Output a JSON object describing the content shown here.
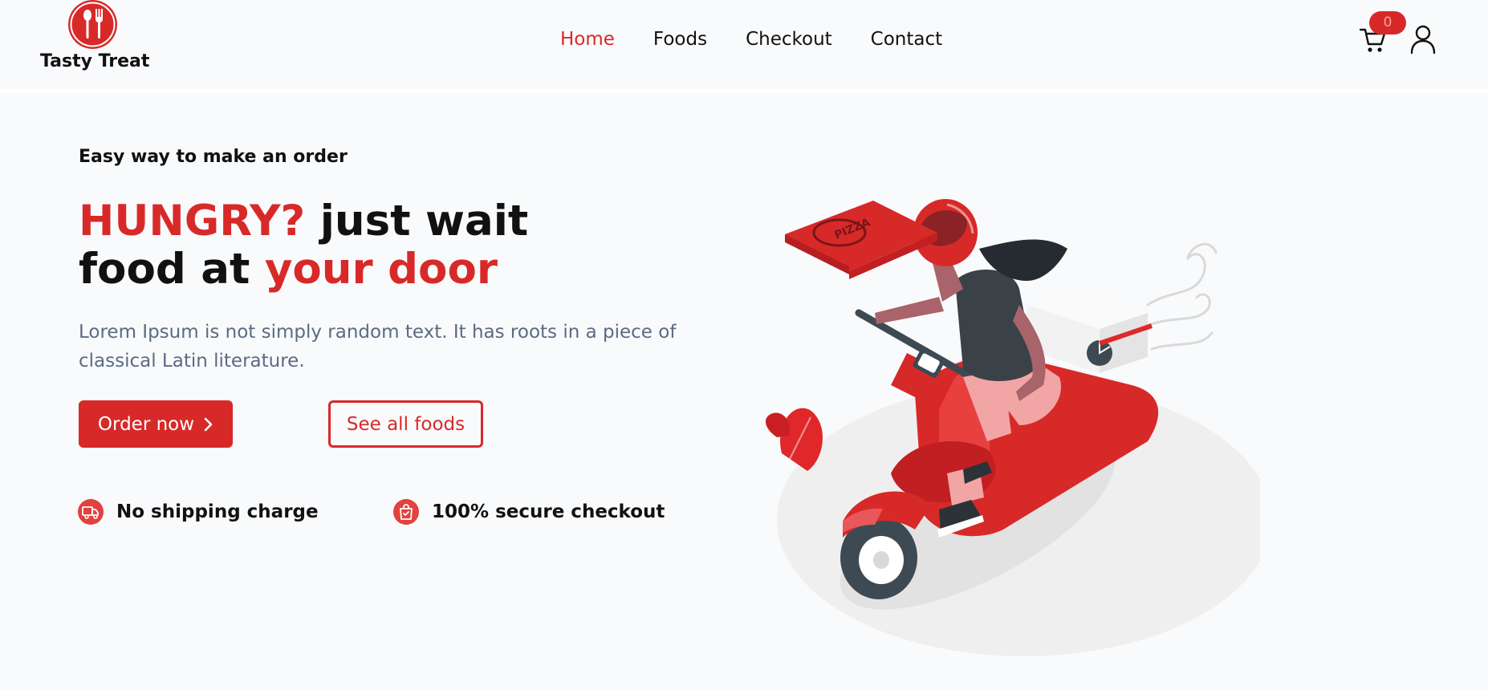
{
  "brand": {
    "name": "Tasty Treat",
    "logo_icon": "spoon-fork-icon"
  },
  "nav": {
    "items": [
      {
        "label": "Home",
        "active": true
      },
      {
        "label": "Foods",
        "active": false
      },
      {
        "label": "Checkout",
        "active": false
      },
      {
        "label": "Contact",
        "active": false
      }
    ]
  },
  "cart": {
    "count": "0",
    "icon": "shopping-cart-icon"
  },
  "user": {
    "icon": "user-icon"
  },
  "hero": {
    "eyebrow": "Easy way to make an order",
    "title": {
      "part1_red": "HUNGRY?",
      "part2": " just wait",
      "part3": "food at ",
      "part4_red": "your door"
    },
    "description": "Lorem Ipsum is not simply random text. It has roots in a piece of classical Latin literature.",
    "order_button": "Order now",
    "all_foods_button": "See all foods"
  },
  "features": [
    {
      "label": "No shipping charge",
      "icon": "delivery-truck-icon"
    },
    {
      "label": "100% secure checkout",
      "icon": "shopping-bag-check-icon"
    }
  ],
  "illustration": {
    "box_text": "PIZZA"
  },
  "colors": {
    "accent": "#d82929",
    "text": "#111111",
    "muted": "#5b6b82",
    "background": "#f9fafc"
  }
}
